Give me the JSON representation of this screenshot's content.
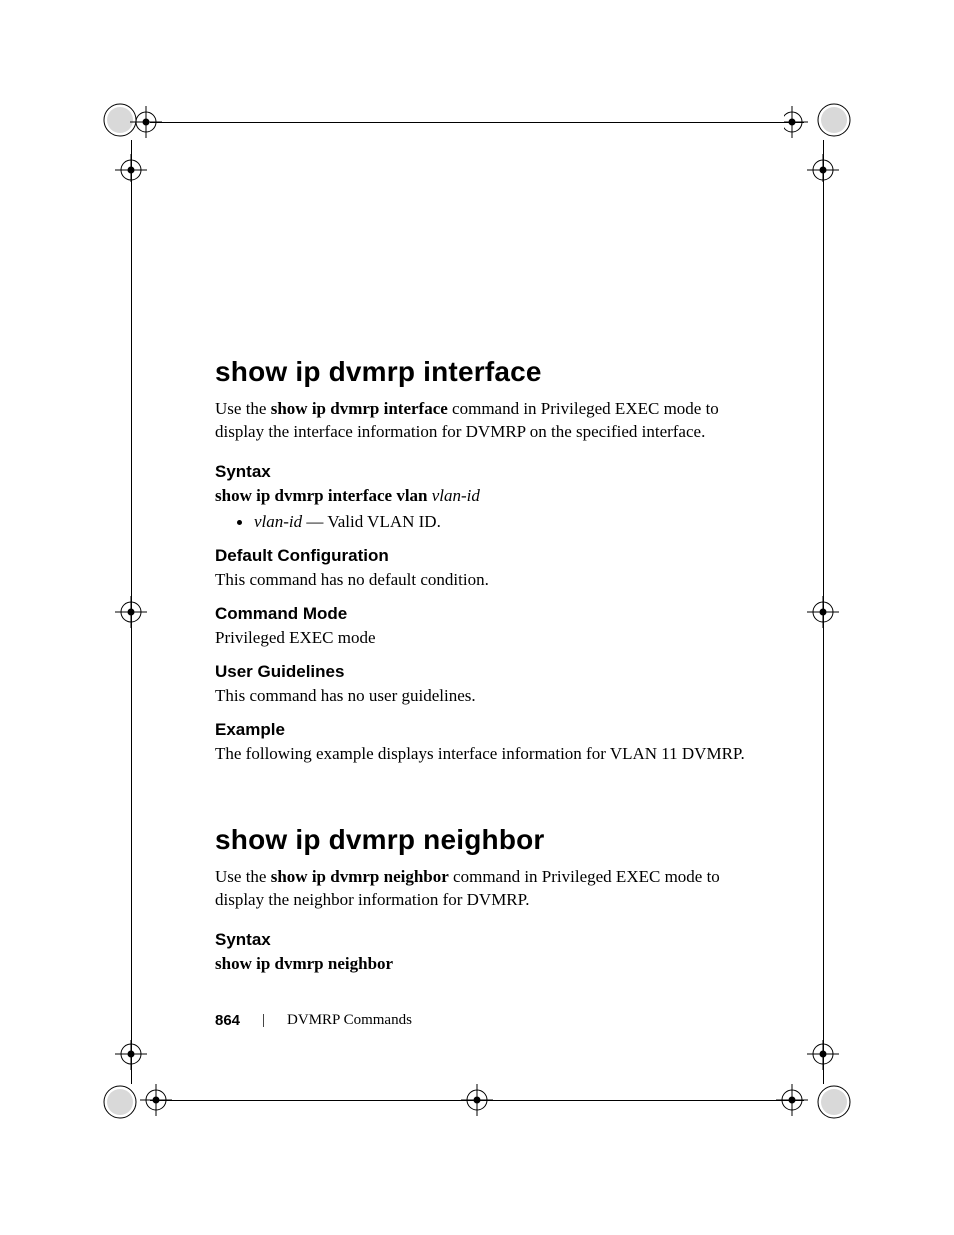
{
  "section1": {
    "title": "show ip dvmrp interface",
    "intro_pre": "Use the ",
    "intro_cmd": "show ip dvmrp interface",
    "intro_post": " command in Privileged EXEC mode to display the interface information for DVMRP on the specified interface.",
    "syntax_h": "Syntax",
    "syntax_cmd": "show ip dvmrp interface vlan ",
    "syntax_arg": "vlan-id",
    "bullet_arg": "vlan-id",
    "bullet_txt": " — Valid VLAN ID.",
    "default_h": "Default Configuration",
    "default_txt": "This command has no default condition.",
    "mode_h": "Command Mode",
    "mode_txt": "Privileged EXEC mode",
    "guide_h": "User Guidelines",
    "guide_txt": "This command has no user guidelines.",
    "example_h": "Example",
    "example_txt": "The following example displays interface information for VLAN 11 DVMRP."
  },
  "section2": {
    "title": "show ip dvmrp neighbor",
    "intro_pre": "Use the ",
    "intro_cmd": "show ip dvmrp neighbor",
    "intro_post": " command in Privileged EXEC mode to display the neighbor information for DVMRP.",
    "syntax_h": "Syntax",
    "syntax_cmd": "show ip dvmrp neighbor"
  },
  "footer": {
    "page_no": "864",
    "sep": "|",
    "title": "DVMRP Commands"
  }
}
